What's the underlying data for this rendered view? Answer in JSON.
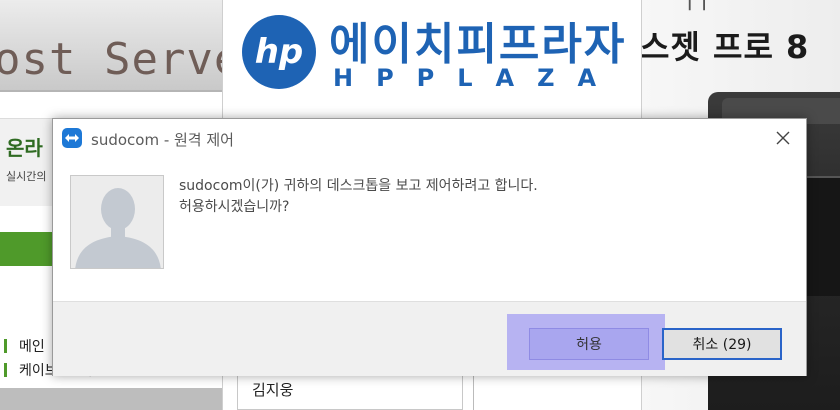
{
  "background": {
    "left_site": {
      "header_text": "ost Serve",
      "online_text": "온라",
      "realtime_text": "실시간의",
      "menu_item_1": "메인",
      "menu_item_2": "케이브  ㅣ 맥 ㅣ"
    },
    "center_site": {
      "brand_korean": "에이치피프라자",
      "brand_latin": "HPPLAZA",
      "logo_text": "hp",
      "person_name": "김지웅"
    },
    "right_site": {
      "product_title": "스젯 프로 8",
      "top_fragment": "|   |"
    }
  },
  "dialog": {
    "title": "sudocom - 원격 제어",
    "message_line1": "sudocom이(가) 귀하의 데스크톱을 보고 제어하려고 합니다.",
    "message_line2": "허용하시겠습니까?",
    "allow_label": "허용",
    "cancel_label": "취소 (29)",
    "close_glyph": "✕"
  },
  "colors": {
    "dialog_accent": "#1d78d6",
    "allow_highlight": "#b7b3f2",
    "cancel_border": "#2a64c9",
    "hp_blue": "#1e63b4"
  },
  "icons": {
    "app_icon": "teamviewer-icon",
    "avatar_icon": "user-silhouette-icon",
    "close_icon": "close-icon"
  }
}
